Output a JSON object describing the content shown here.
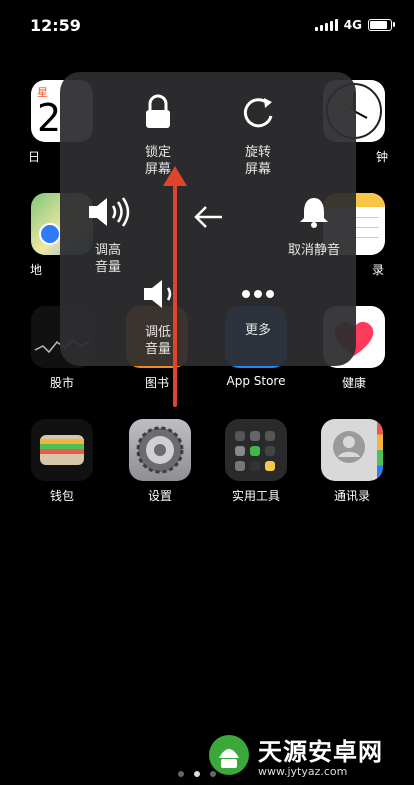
{
  "status_bar": {
    "time": "12:59",
    "network": "4G",
    "battery_percent": 85
  },
  "apps": {
    "calendar": {
      "label": "日",
      "weekday": "星",
      "day": "2"
    },
    "clock": {
      "label": "钟"
    },
    "maps": {
      "label": "地"
    },
    "notes": {
      "label": "录"
    },
    "stocks": {
      "label": "股市"
    },
    "books": {
      "label": "图书"
    },
    "appstore": {
      "label": "App Store"
    },
    "health": {
      "label": "健康"
    },
    "wallet": {
      "label": "钱包"
    },
    "settings": {
      "label": "设置"
    },
    "utilities": {
      "label": "实用工具"
    },
    "contacts": {
      "label": "通讯录"
    }
  },
  "assistive_menu": {
    "lock_screen": {
      "line1": "锁定",
      "line2": "屏幕"
    },
    "rotate_screen": {
      "line1": "旋转",
      "line2": "屏幕"
    },
    "volume_up": {
      "line1": "调高",
      "line2": "音量"
    },
    "mute": {
      "label": "取消静音"
    },
    "volume_down": {
      "line1": "调低",
      "line2": "音量"
    },
    "more": {
      "label": "更多"
    }
  },
  "watermark": {
    "title": "天源安卓网",
    "url": "www.jytyaz.com"
  },
  "colors": {
    "menu_bg": "#2e2e30",
    "arrow": "#e0442a",
    "accent_green": "#3aa83a"
  }
}
